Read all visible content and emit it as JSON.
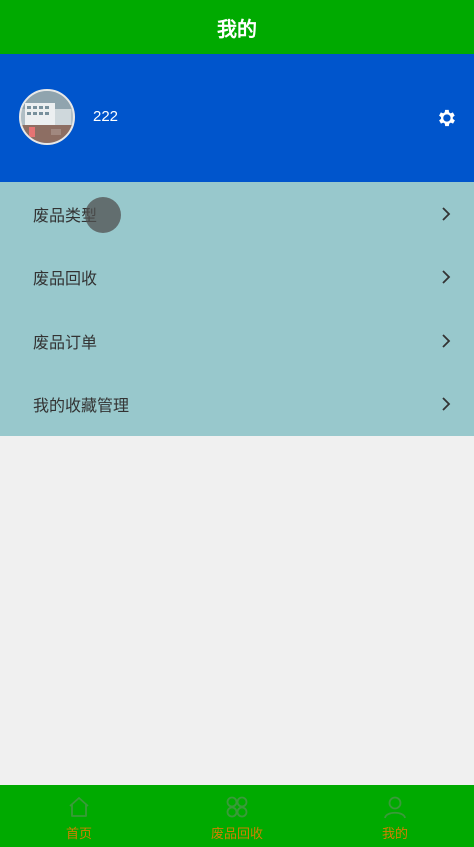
{
  "header": {
    "title": "我的"
  },
  "profile": {
    "username": "222",
    "avatar_icon": "avatar-photo",
    "settings_icon": "gear-icon"
  },
  "menu": {
    "items": [
      {
        "label": "废品类型",
        "icon": "chevron-right-icon"
      },
      {
        "label": "废品回收",
        "icon": "chevron-right-icon"
      },
      {
        "label": "废品订单",
        "icon": "chevron-right-icon"
      },
      {
        "label": "我的收藏管理",
        "icon": "chevron-right-icon"
      }
    ]
  },
  "tabbar": {
    "tabs": [
      {
        "label": "首页",
        "icon": "home-icon"
      },
      {
        "label": "废品回收",
        "icon": "clover-icon"
      },
      {
        "label": "我的",
        "icon": "user-icon"
      }
    ],
    "label_color": "#d08000"
  },
  "colors": {
    "header_bg": "#00aa00",
    "profile_bg": "#0055cc",
    "menu_bg": "#98c8cc",
    "page_bg": "#f0f0f0"
  }
}
